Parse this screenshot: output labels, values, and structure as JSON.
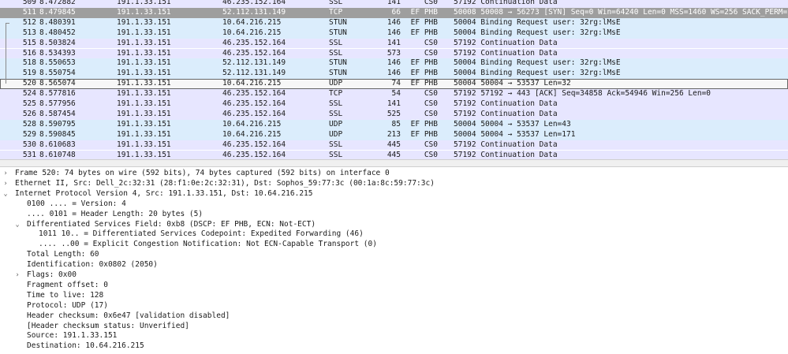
{
  "packet_list": {
    "rows": [
      {
        "no": "509",
        "time": "8.472882",
        "src": "191.1.33.151",
        "dst": "46.235.152.164",
        "proto": "SSL",
        "len": "141",
        "dscp": "CS0",
        "info": "57192 Continuation Data",
        "bg": "#e7e6ff"
      },
      {
        "no": "511",
        "time": "8.479845",
        "src": "191.1.33.151",
        "dst": "52.112.131.149",
        "proto": "TCP",
        "len": "66",
        "dscp": "EF PHB",
        "info": "50008 50008 → 56273 [SYN] Seq=0 Win=64240 Len=0 MSS=1460 WS=256 SACK_PERM=1",
        "bg": "#9e9e9e",
        "selected": true
      },
      {
        "no": "512",
        "time": "8.480391",
        "src": "191.1.33.151",
        "dst": "10.64.216.215",
        "proto": "STUN",
        "len": "146",
        "dscp": "EF PHB",
        "info": "50004 Binding Request user: 32rg:lMsE",
        "bg": "#dbedfc"
      },
      {
        "no": "513",
        "time": "8.480452",
        "src": "191.1.33.151",
        "dst": "10.64.216.215",
        "proto": "STUN",
        "len": "146",
        "dscp": "EF PHB",
        "info": "50004 Binding Request user: 32rg:lMsE",
        "bg": "#dbedfc"
      },
      {
        "no": "515",
        "time": "8.503824",
        "src": "191.1.33.151",
        "dst": "46.235.152.164",
        "proto": "SSL",
        "len": "141",
        "dscp": "CS0",
        "info": "57192 Continuation Data",
        "bg": "#e7e6ff"
      },
      {
        "no": "516",
        "time": "8.534393",
        "src": "191.1.33.151",
        "dst": "46.235.152.164",
        "proto": "SSL",
        "len": "573",
        "dscp": "CS0",
        "info": "57192 Continuation Data",
        "bg": "#e7e6ff"
      },
      {
        "no": "518",
        "time": "8.550653",
        "src": "191.1.33.151",
        "dst": "52.112.131.149",
        "proto": "STUN",
        "len": "146",
        "dscp": "EF PHB",
        "info": "50004 Binding Request user: 32rg:lMsE",
        "bg": "#dbedfc"
      },
      {
        "no": "519",
        "time": "8.550754",
        "src": "191.1.33.151",
        "dst": "52.112.131.149",
        "proto": "STUN",
        "len": "146",
        "dscp": "EF PHB",
        "info": "50004 Binding Request user: 32rg:lMsE",
        "bg": "#dbedfc"
      },
      {
        "no": "520",
        "time": "8.565074",
        "src": "191.1.33.151",
        "dst": "10.64.216.215",
        "proto": "UDP",
        "len": "74",
        "dscp": "EF PHB",
        "info": "50004 50004 → 53537 Len=32",
        "bg": "#f7f7f7",
        "focused": true
      },
      {
        "no": "524",
        "time": "8.577816",
        "src": "191.1.33.151",
        "dst": "46.235.152.164",
        "proto": "TCP",
        "len": "54",
        "dscp": "CS0",
        "info": "57192 57192 → 443 [ACK] Seq=34858 Ack=54946 Win=256 Len=0",
        "bg": "#e7e6ff"
      },
      {
        "no": "525",
        "time": "8.577956",
        "src": "191.1.33.151",
        "dst": "46.235.152.164",
        "proto": "SSL",
        "len": "141",
        "dscp": "CS0",
        "info": "57192 Continuation Data",
        "bg": "#e7e6ff"
      },
      {
        "no": "526",
        "time": "8.587454",
        "src": "191.1.33.151",
        "dst": "46.235.152.164",
        "proto": "SSL",
        "len": "525",
        "dscp": "CS0",
        "info": "57192 Continuation Data",
        "bg": "#e7e6ff"
      },
      {
        "no": "528",
        "time": "8.590795",
        "src": "191.1.33.151",
        "dst": "10.64.216.215",
        "proto": "UDP",
        "len": "85",
        "dscp": "EF PHB",
        "info": "50004 50004 → 53537 Len=43",
        "bg": "#dbedfc"
      },
      {
        "no": "529",
        "time": "8.590845",
        "src": "191.1.33.151",
        "dst": "10.64.216.215",
        "proto": "UDP",
        "len": "213",
        "dscp": "EF PHB",
        "info": "50004 50004 → 53537 Len=171",
        "bg": "#dbedfc"
      },
      {
        "no": "530",
        "time": "8.610683",
        "src": "191.1.33.151",
        "dst": "46.235.152.164",
        "proto": "SSL",
        "len": "445",
        "dscp": "CS0",
        "info": "57192 Continuation Data",
        "bg": "#e7e6ff"
      },
      {
        "no": "531",
        "time": "8.610748",
        "src": "191.1.33.151",
        "dst": "46.235.152.164",
        "proto": "SSL",
        "len": "445",
        "dscp": "CS0",
        "info": "57192 Continuation Data",
        "bg": "#e7e6ff"
      }
    ]
  },
  "details": {
    "rows": [
      {
        "level": 0,
        "toggle": "›",
        "text": "Frame 520: 74 bytes on wire (592 bits), 74 bytes captured (592 bits) on interface 0"
      },
      {
        "level": 0,
        "toggle": "›",
        "text": "Ethernet II, Src: Dell_2c:32:31 (28:f1:0e:2c:32:31), Dst: Sophos_59:77:3c (00:1a:8c:59:77:3c)"
      },
      {
        "level": 0,
        "toggle": "⌄",
        "text": "Internet Protocol Version 4, Src: 191.1.33.151, Dst: 10.64.216.215"
      },
      {
        "level": 1,
        "toggle": "",
        "text": "0100 .... = Version: 4"
      },
      {
        "level": 1,
        "toggle": "",
        "text": ".... 0101 = Header Length: 20 bytes (5)"
      },
      {
        "level": 1,
        "toggle": "⌄",
        "text": "Differentiated Services Field: 0xb8 (DSCP: EF PHB, ECN: Not-ECT)"
      },
      {
        "level": 2,
        "toggle": "",
        "text": "1011 10.. = Differentiated Services Codepoint: Expedited Forwarding (46)"
      },
      {
        "level": 2,
        "toggle": "",
        "text": ".... ..00 = Explicit Congestion Notification: Not ECN-Capable Transport (0)"
      },
      {
        "level": 1,
        "toggle": "",
        "text": "Total Length: 60"
      },
      {
        "level": 1,
        "toggle": "",
        "text": "Identification: 0x0802 (2050)"
      },
      {
        "level": 1,
        "toggle": "›",
        "text": "Flags: 0x00"
      },
      {
        "level": 1,
        "toggle": "",
        "text": "Fragment offset: 0"
      },
      {
        "level": 1,
        "toggle": "",
        "text": "Time to live: 128"
      },
      {
        "level": 1,
        "toggle": "",
        "text": "Protocol: UDP (17)"
      },
      {
        "level": 1,
        "toggle": "",
        "text": "Header checksum: 0x6e47 [validation disabled]"
      },
      {
        "level": 1,
        "toggle": "",
        "text": "[Header checksum status: Unverified]"
      },
      {
        "level": 1,
        "toggle": "",
        "text": "Source: 191.1.33.151"
      },
      {
        "level": 1,
        "toggle": "",
        "text": "Destination: 10.64.216.215"
      }
    ]
  }
}
